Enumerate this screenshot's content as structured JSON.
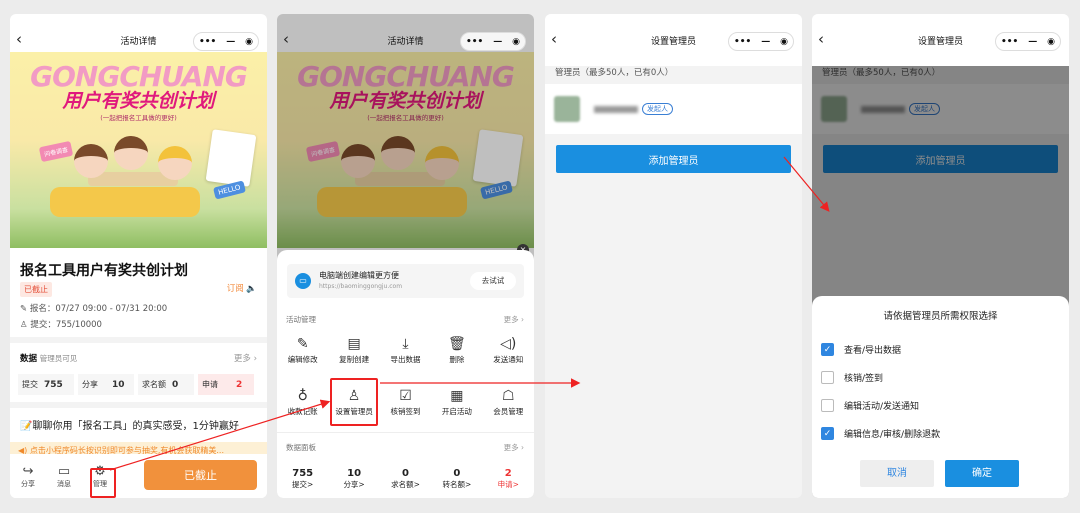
{
  "phone1": {
    "nav_title": "活动详情",
    "capsule": {
      "dots": "•••",
      "dash": "—",
      "circle": "◉"
    },
    "banner": {
      "line1": "GONGCHUANG",
      "line2": "用户有奖共创计划",
      "line3": "(一起把报名工具做的更好)",
      "note": "问卷调查",
      "hello": "HELLO"
    },
    "title": "报名工具用户有奖共创计划",
    "status": "已截止",
    "subscribe": "订阅",
    "signup_time": "报名：07/27 09:00 - 07/31 20:00",
    "submits": "提交：755/10000",
    "data_title": "数据",
    "data_sub": "管理员可见",
    "more": "更多",
    "stats": [
      {
        "label": "提交",
        "value": "755"
      },
      {
        "label": "分享",
        "value": "10"
      },
      {
        "label": "求名额",
        "value": "0"
      },
      {
        "label": "申请",
        "value": "2"
      }
    ],
    "post_text": "聊聊你用「报名工具」的真实感受，1分钟赢好",
    "notice": "点击小程序码长按识别即可参与抽奖,有机会获取精美...",
    "tabs": [
      {
        "label": "分享",
        "icon": "share-icon"
      },
      {
        "label": "消息",
        "icon": "message-icon"
      },
      {
        "label": "管理",
        "icon": "gear-icon"
      }
    ],
    "end_button": "已截止"
  },
  "phone2": {
    "nav_title": "活动详情",
    "pc_text": "电脑端创建编辑更方便",
    "pc_url": "https://baominggongju.com",
    "try_button": "去试试",
    "activity_section": "活动管理",
    "more": "更多",
    "row1": [
      "编辑修改",
      "复制创建",
      "导出数据",
      "删除",
      "发送通知"
    ],
    "row2": [
      "收款记账",
      "设置管理员",
      "核销签到",
      "开启活动",
      "会员管理"
    ],
    "data_section": "数据面板",
    "data": [
      {
        "value": "755",
        "label": "提交>"
      },
      {
        "value": "10",
        "label": "分享>"
      },
      {
        "value": "0",
        "label": "求名额>"
      },
      {
        "value": "0",
        "label": "转名额>"
      },
      {
        "value": "2",
        "label": "申请>"
      }
    ]
  },
  "phone3": {
    "nav_title": "设置管理员",
    "header": "管理员（最多50人，已有0人）",
    "founder_tag": "发起人",
    "add_button": "添加管理员"
  },
  "phone4": {
    "nav_title": "设置管理员",
    "header": "管理员（最多50人，已有0人）",
    "founder_tag": "发起人",
    "add_button": "添加管理员",
    "dialog_title": "请依据管理员所需权限选择",
    "options": [
      {
        "label": "查看/导出数据",
        "checked": true
      },
      {
        "label": "核销/签到",
        "checked": false
      },
      {
        "label": "编辑活动/发送通知",
        "checked": false
      },
      {
        "label": "编辑信息/审核/删除退款",
        "checked": true
      }
    ],
    "cancel": "取消",
    "confirm": "确定"
  },
  "colors": {
    "orange": "#f1913c",
    "blue": "#1a8fe0",
    "red": "#e22222",
    "pink": "#e0197d"
  }
}
